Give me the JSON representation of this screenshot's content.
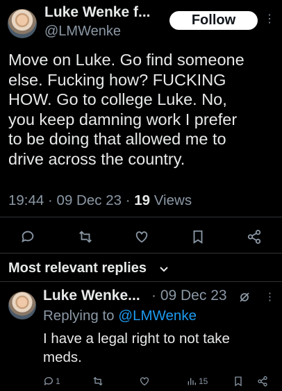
{
  "author": {
    "display_name": "Luke Wenke f...",
    "handle": "@LMWenke",
    "follow_label": "Follow",
    "more_icon": "⋮"
  },
  "tweet": {
    "lines": [
      "Move on Luke.  Go find someone",
      "else.  Fucking how?  FUCKING",
      "HOW.  Go to college Luke.  No,",
      "you keep damning work I prefer",
      "to be doing that allowed me to",
      "drive across the country."
    ],
    "time": "19:44",
    "date": "09 Dec 23",
    "views_count": "19",
    "views_label": "Views"
  },
  "actions": [
    "reply-icon",
    "retweet-icon",
    "like-icon",
    "bookmark-icon",
    "share-icon"
  ],
  "replies_section": {
    "title": "Most relevant replies",
    "chevron": "chevron-down-icon"
  },
  "reply": {
    "display_name": "Luke Wenke...",
    "date": "· 09 Dec 23",
    "replying_prefix": "Replying to",
    "replying_handle": "@LMWenke",
    "lines": [
      "I have a legal right to not take",
      "meds."
    ],
    "reply_count": "1",
    "views_count": "15",
    "more_icon": "⋮"
  },
  "colors": {
    "background": "#000000",
    "text": "#e7e9ea",
    "secondary": "#8b98a5",
    "link": "#1d9bf0",
    "divider": "#2f3336",
    "follow_bg": "#ffffff"
  }
}
